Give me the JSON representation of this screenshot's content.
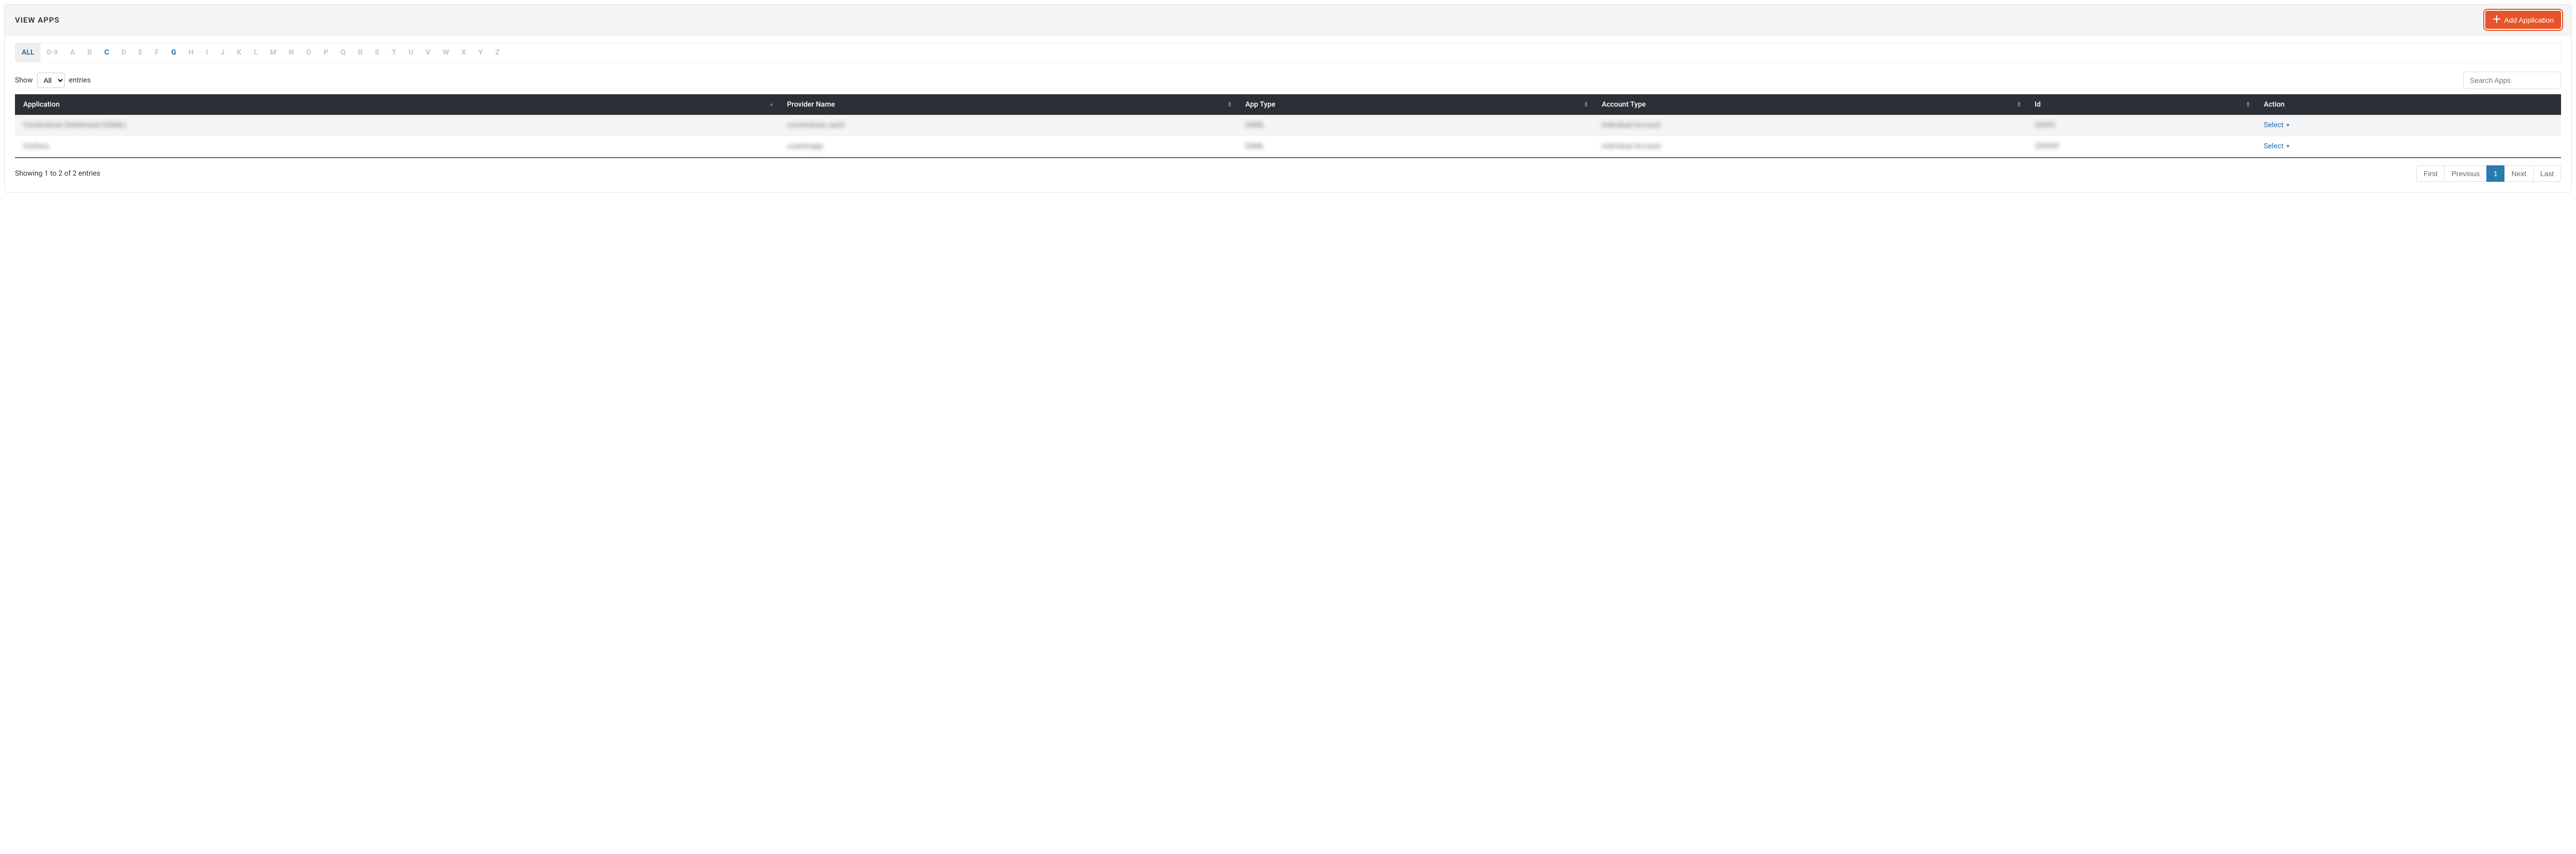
{
  "header": {
    "title": "VIEW APPS",
    "add_button_label": "Add Application"
  },
  "alpha_filter": {
    "items": [
      "ALL",
      "0-9",
      "A",
      "B",
      "C",
      "D",
      "E",
      "F",
      "G",
      "H",
      "I",
      "J",
      "K",
      "L",
      "M",
      "N",
      "O",
      "P",
      "Q",
      "R",
      "S",
      "T",
      "U",
      "V",
      "W",
      "X",
      "Y",
      "Z"
    ],
    "active": "ALL",
    "has_data": [
      "C",
      "G"
    ]
  },
  "controls": {
    "show_label": "Show",
    "entries_label": "entries",
    "show_value": "All",
    "search_placeholder": "Search Apps"
  },
  "table": {
    "columns": {
      "application": "Application",
      "provider_name": "Provider Name",
      "app_type": "App Type",
      "account_type": "Account Type",
      "id": "Id",
      "action": "Action"
    },
    "sort": {
      "column": "application",
      "dir": "asc"
    },
    "rows": [
      {
        "application": "Cornerstone OnDemand (SAML)",
        "provider_name": "cornerstone_saml",
        "app_type": "SAML",
        "account_type": "Individual Account",
        "id": "26393",
        "action_label": "Select"
      },
      {
        "application": "Grafana",
        "provider_name": "customapp",
        "app_type": "SAML",
        "account_type": "Individual Account",
        "id": "269999",
        "action_label": "Select"
      }
    ]
  },
  "footer": {
    "info": "Showing 1 to 2 of 2 entries",
    "pagination": {
      "first": "First",
      "previous": "Previous",
      "page": "1",
      "next": "Next",
      "last": "Last"
    }
  }
}
